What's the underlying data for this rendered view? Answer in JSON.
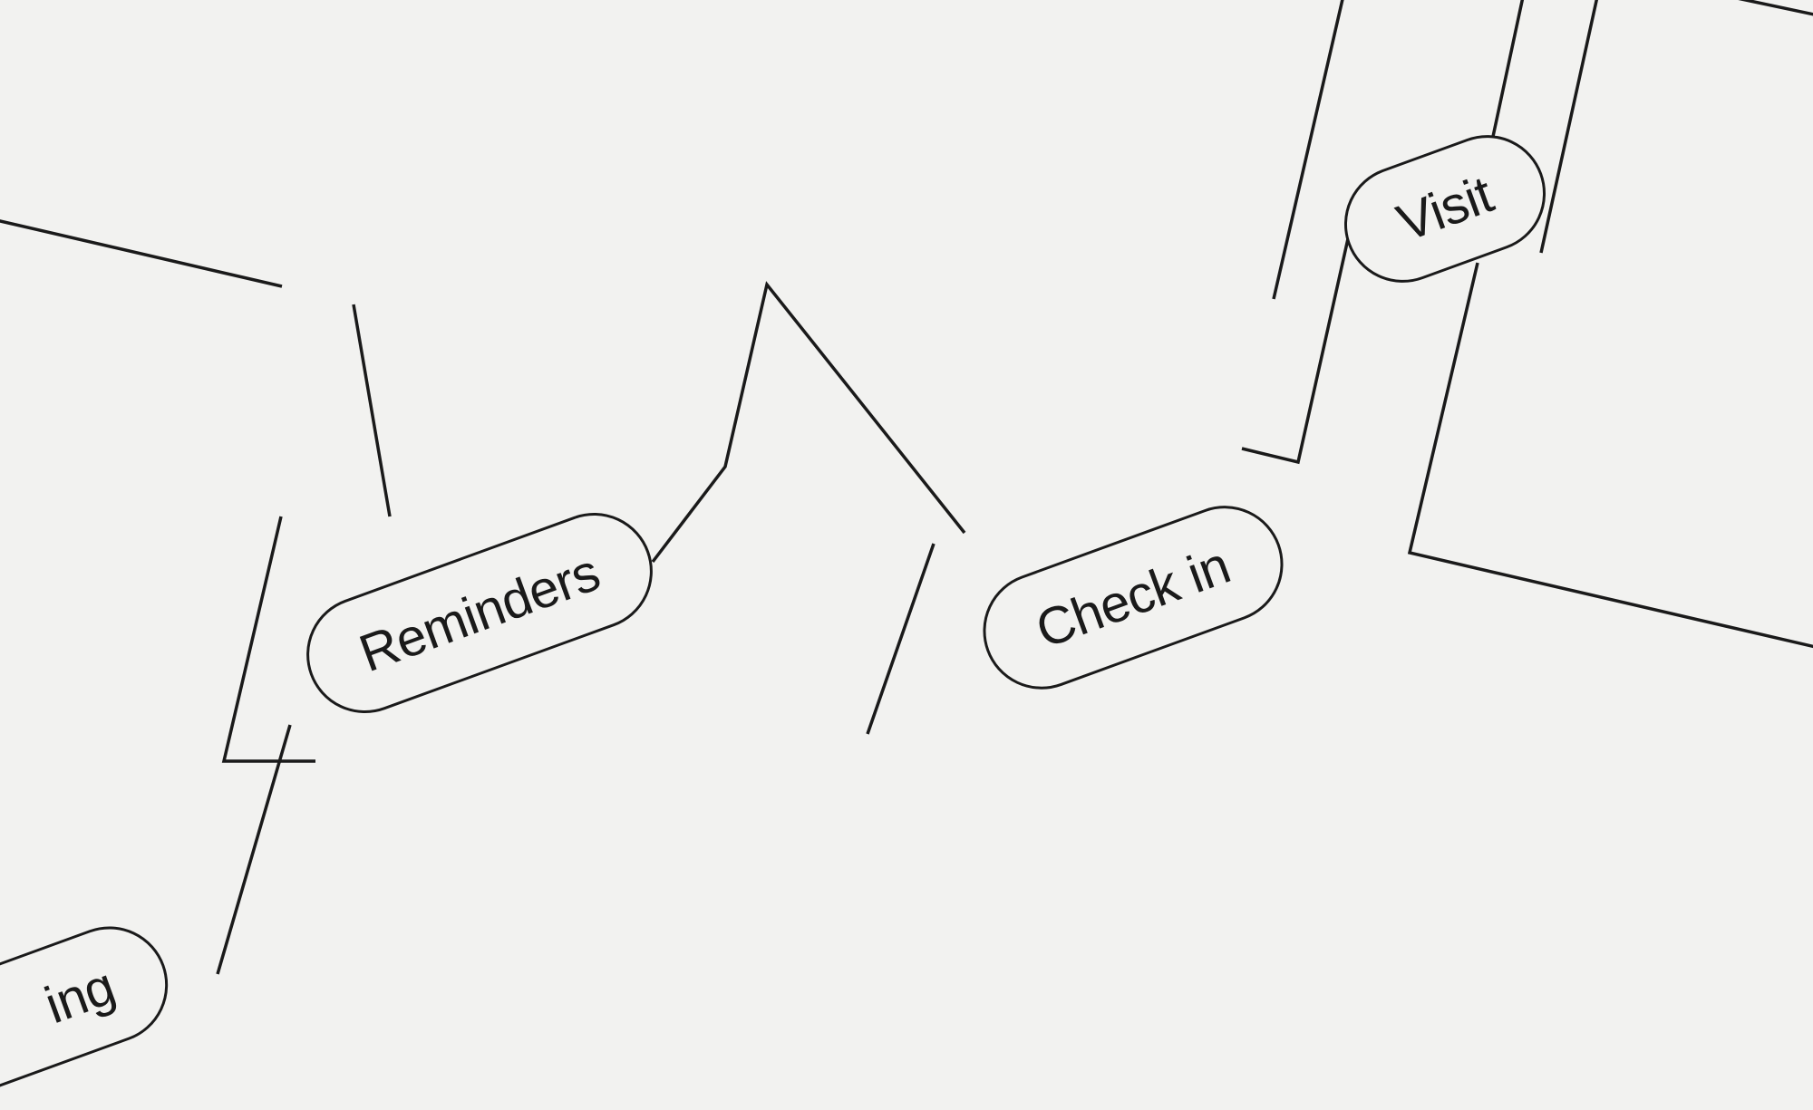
{
  "nodes": {
    "visit": {
      "label": "Visit"
    },
    "checkin": {
      "label": "Check in"
    },
    "reminders": {
      "label": "Reminders"
    },
    "partial_bottom_left": {
      "label": "ing"
    }
  },
  "style": {
    "background": "#f2f2f0",
    "stroke": "#1a1a1a",
    "rotation_deg": -20
  }
}
